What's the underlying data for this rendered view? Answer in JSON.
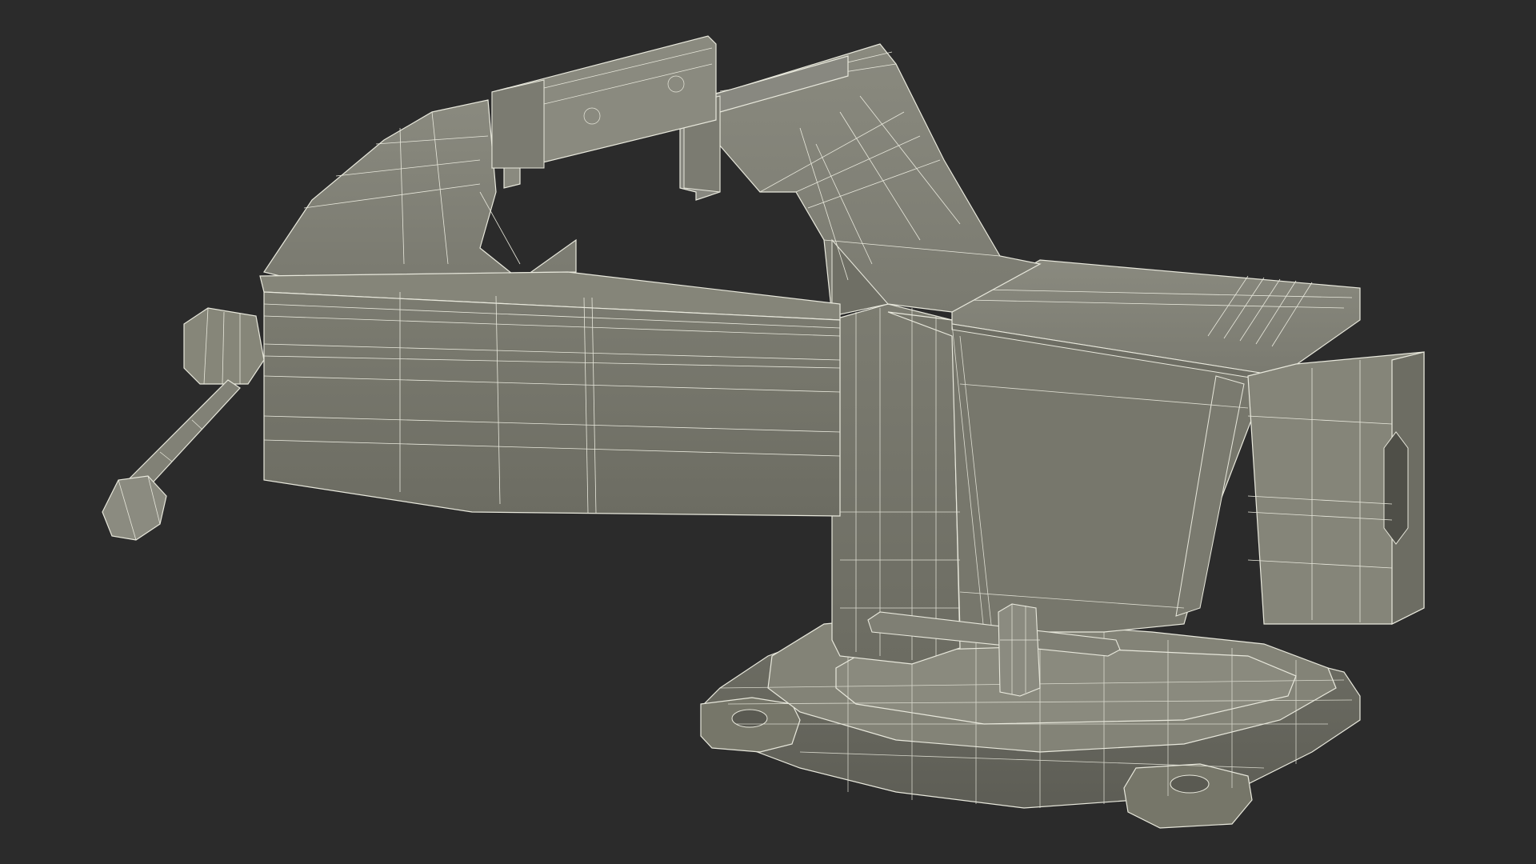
{
  "scene": {
    "background_color": "#2b2b2b",
    "surface_color": "#7d7d72",
    "surface_dark": "#6a6a60",
    "surface_light": "#8e8e83",
    "wire_color": "#e8e8dc",
    "subject": "bench-vise-wireframe-render"
  }
}
